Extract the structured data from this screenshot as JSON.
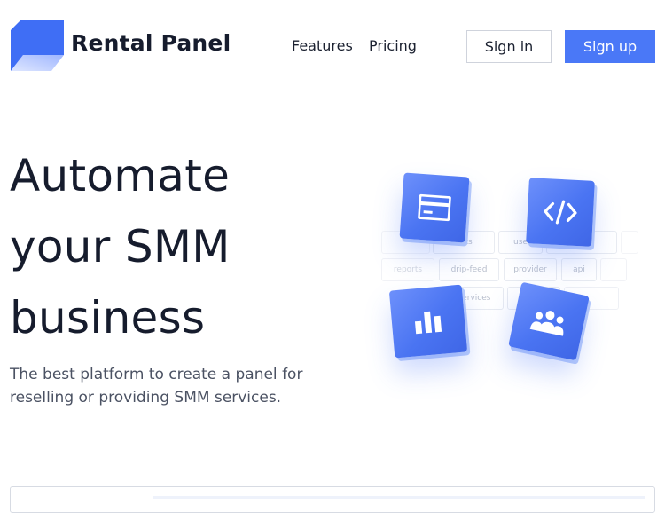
{
  "brand": {
    "name": "Rental Panel",
    "logo_icon": "brand-logo-mark",
    "accent": "#4a78f7"
  },
  "nav": {
    "features": "Features",
    "pricing": "Pricing"
  },
  "auth": {
    "sign_in": "Sign in",
    "sign_up": "Sign up"
  },
  "hero": {
    "title_lines": [
      "Automate",
      "your SMM",
      "business"
    ],
    "subtitle": "The best platform to create a panel for reselling or providing SMM services."
  },
  "illustration": {
    "tags": [
      "ents",
      "use",
      "reports",
      "drip-feed",
      "provider",
      "api",
      "services"
    ],
    "tiles": [
      "card-icon",
      "code-icon",
      "bar-chart-icon",
      "users-icon"
    ]
  }
}
